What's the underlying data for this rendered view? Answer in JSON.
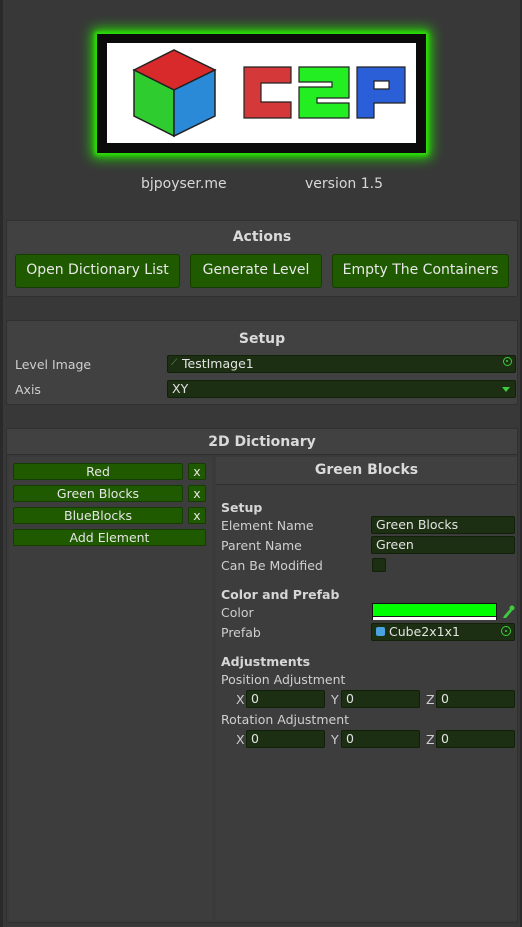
{
  "header": {
    "author": "bjpoyser.me",
    "version": "version 1.5"
  },
  "actions": {
    "title": "Actions",
    "open_dictionary": "Open Dictionary List",
    "generate_level": "Generate Level",
    "empty_containers": "Empty The Containers"
  },
  "setup": {
    "title": "Setup",
    "level_image_label": "Level Image",
    "level_image_value": "TestImage1",
    "axis_label": "Axis",
    "axis_value": "XY"
  },
  "dictionary": {
    "title": "2D Dictionary",
    "elements": [
      {
        "name": "Red",
        "remove": "x"
      },
      {
        "name": "Green Blocks",
        "remove": "x"
      },
      {
        "name": "BlueBlocks",
        "remove": "x"
      }
    ],
    "add_element": "Add Element"
  },
  "detail": {
    "title": "Green Blocks",
    "setup_heading": "Setup",
    "element_name_label": "Element Name",
    "element_name_value": "Green Blocks",
    "parent_name_label": "Parent Name",
    "parent_name_value": "Green",
    "can_be_modified_label": "Can Be Modified",
    "can_be_modified": false,
    "color_prefab_heading": "Color and Prefab",
    "color_label": "Color",
    "color_value": "#00ff00",
    "prefab_label": "Prefab",
    "prefab_value": "Cube2x1x1",
    "adjustments_heading": "Adjustments",
    "position_label": "Position Adjustment",
    "position": {
      "x_label": "X",
      "x": "0",
      "y_label": "Y",
      "y": "0",
      "z_label": "Z",
      "z": "0"
    },
    "rotation_label": "Rotation Adjustment",
    "rotation": {
      "x_label": "X",
      "x": "0",
      "y_label": "Y",
      "y": "0",
      "z_label": "Z",
      "z": "0"
    }
  },
  "colors": {
    "button_green": "#1f5a00",
    "field_bg": "#1c2f12",
    "accent_green": "#22dd00"
  }
}
